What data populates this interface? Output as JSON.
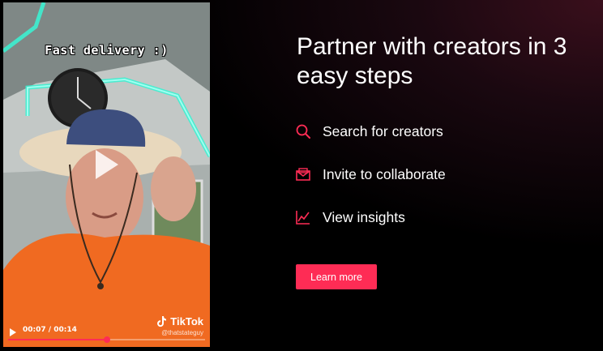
{
  "video": {
    "caption": "Fast delivery :)",
    "current_time": "00:07",
    "duration": "00:14",
    "time_separator": " / ",
    "progress_fraction": 0.5,
    "watermark_logo": "TikTok",
    "watermark_handle": "@thatstateguy",
    "accent_color": "#fe2c55"
  },
  "promo": {
    "headline": "Partner with creators in 3 easy steps",
    "steps": [
      {
        "icon": "search-icon",
        "label": "Search for creators"
      },
      {
        "icon": "envelope-icon",
        "label": "Invite to collaborate"
      },
      {
        "icon": "chart-line-icon",
        "label": "View insights"
      }
    ],
    "cta_label": "Learn more",
    "accent_color": "#fe2c55"
  }
}
